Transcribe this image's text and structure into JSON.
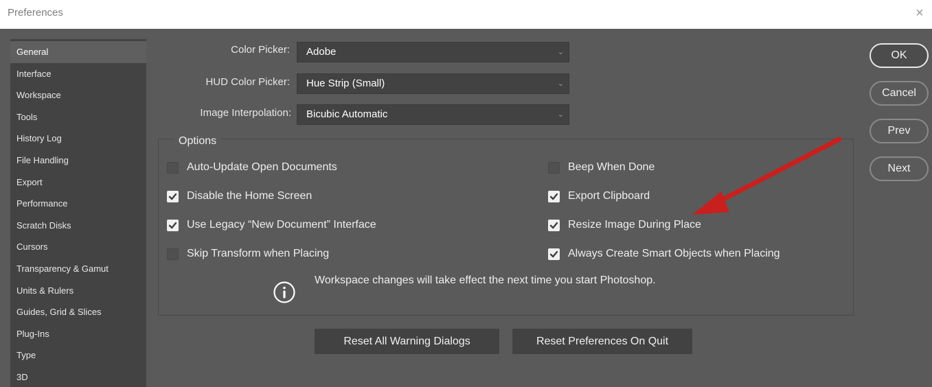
{
  "window": {
    "title": "Preferences",
    "close_glyph": "×"
  },
  "sidebar": {
    "items": [
      {
        "label": "General",
        "selected": true
      },
      {
        "label": "Interface"
      },
      {
        "label": "Workspace"
      },
      {
        "label": "Tools"
      },
      {
        "label": "History Log"
      },
      {
        "label": "File Handling"
      },
      {
        "label": "Export"
      },
      {
        "label": "Performance"
      },
      {
        "label": "Scratch Disks"
      },
      {
        "label": "Cursors"
      },
      {
        "label": "Transparency & Gamut"
      },
      {
        "label": "Units & Rulers"
      },
      {
        "label": "Guides, Grid & Slices"
      },
      {
        "label": "Plug-Ins"
      },
      {
        "label": "Type"
      },
      {
        "label": "3D"
      }
    ]
  },
  "fields": {
    "color_picker": {
      "label": "Color Picker:",
      "value": "Adobe"
    },
    "hud_color_picker": {
      "label": "HUD Color Picker:",
      "value": "Hue Strip (Small)"
    },
    "image_interpolation": {
      "label": "Image Interpolation:",
      "value": "Bicubic Automatic"
    }
  },
  "options": {
    "title": "Options",
    "left": [
      {
        "label": "Auto-Update Open Documents",
        "checked": false
      },
      {
        "label": "Disable the Home Screen",
        "checked": true
      },
      {
        "label": "Use Legacy “New Document” Interface",
        "checked": true
      },
      {
        "label": "Skip Transform when Placing",
        "checked": false
      }
    ],
    "right": [
      {
        "label": "Beep When Done",
        "checked": false
      },
      {
        "label": "Export Clipboard",
        "checked": true
      },
      {
        "label": "Resize Image During Place",
        "checked": true
      },
      {
        "label": "Always Create Smart Objects when Placing",
        "checked": true
      }
    ],
    "info_icon": "info-circle-icon",
    "info_text": "Workspace changes will take effect the next time you start Photoshop."
  },
  "buttons": {
    "reset_warnings": "Reset All Warning Dialogs",
    "reset_prefs": "Reset Preferences On Quit",
    "ok": "OK",
    "cancel": "Cancel",
    "prev": "Prev",
    "next": "Next"
  },
  "annotation": {
    "arrow_color": "#c8201e"
  },
  "colors": {
    "panel_bg": "#5a5a5a",
    "sidebar_bg": "#434343",
    "selected_item_bg": "#5f5f5f"
  }
}
